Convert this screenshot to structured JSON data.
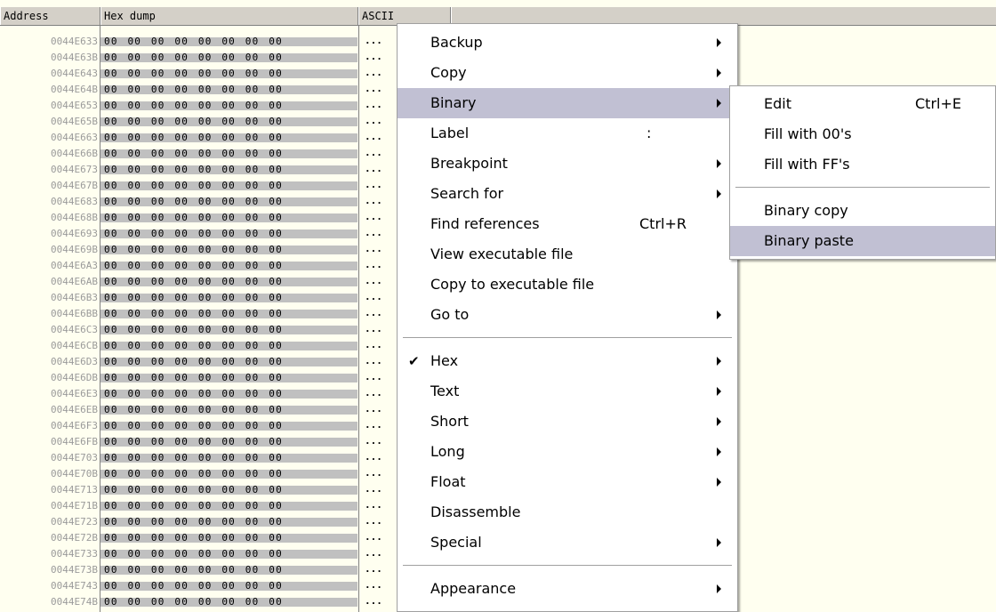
{
  "columns": {
    "address": "Address",
    "hex": "Hex dump",
    "ascii": "ASCII"
  },
  "dump_rows": [
    {
      "addr": "0044E633",
      "hex": "00 00 00 00 00 00 00 00",
      "ascii": "..."
    },
    {
      "addr": "0044E63B",
      "hex": "00 00 00 00 00 00 00 00",
      "ascii": "..."
    },
    {
      "addr": "0044E643",
      "hex": "00 00 00 00 00 00 00 00",
      "ascii": "..."
    },
    {
      "addr": "0044E64B",
      "hex": "00 00 00 00 00 00 00 00",
      "ascii": "..."
    },
    {
      "addr": "0044E653",
      "hex": "00 00 00 00 00 00 00 00",
      "ascii": "..."
    },
    {
      "addr": "0044E65B",
      "hex": "00 00 00 00 00 00 00 00",
      "ascii": "..."
    },
    {
      "addr": "0044E663",
      "hex": "00 00 00 00 00 00 00 00",
      "ascii": "..."
    },
    {
      "addr": "0044E66B",
      "hex": "00 00 00 00 00 00 00 00",
      "ascii": "..."
    },
    {
      "addr": "0044E673",
      "hex": "00 00 00 00 00 00 00 00",
      "ascii": "..."
    },
    {
      "addr": "0044E67B",
      "hex": "00 00 00 00 00 00 00 00",
      "ascii": "..."
    },
    {
      "addr": "0044E683",
      "hex": "00 00 00 00 00 00 00 00",
      "ascii": "..."
    },
    {
      "addr": "0044E68B",
      "hex": "00 00 00 00 00 00 00 00",
      "ascii": "..."
    },
    {
      "addr": "0044E693",
      "hex": "00 00 00 00 00 00 00 00",
      "ascii": "..."
    },
    {
      "addr": "0044E69B",
      "hex": "00 00 00 00 00 00 00 00",
      "ascii": "..."
    },
    {
      "addr": "0044E6A3",
      "hex": "00 00 00 00 00 00 00 00",
      "ascii": "..."
    },
    {
      "addr": "0044E6AB",
      "hex": "00 00 00 00 00 00 00 00",
      "ascii": "..."
    },
    {
      "addr": "0044E6B3",
      "hex": "00 00 00 00 00 00 00 00",
      "ascii": "..."
    },
    {
      "addr": "0044E6BB",
      "hex": "00 00 00 00 00 00 00 00",
      "ascii": "..."
    },
    {
      "addr": "0044E6C3",
      "hex": "00 00 00 00 00 00 00 00",
      "ascii": "..."
    },
    {
      "addr": "0044E6CB",
      "hex": "00 00 00 00 00 00 00 00",
      "ascii": "..."
    },
    {
      "addr": "0044E6D3",
      "hex": "00 00 00 00 00 00 00 00",
      "ascii": "..."
    },
    {
      "addr": "0044E6DB",
      "hex": "00 00 00 00 00 00 00 00",
      "ascii": "..."
    },
    {
      "addr": "0044E6E3",
      "hex": "00 00 00 00 00 00 00 00",
      "ascii": "..."
    },
    {
      "addr": "0044E6EB",
      "hex": "00 00 00 00 00 00 00 00",
      "ascii": "..."
    },
    {
      "addr": "0044E6F3",
      "hex": "00 00 00 00 00 00 00 00",
      "ascii": "..."
    },
    {
      "addr": "0044E6FB",
      "hex": "00 00 00 00 00 00 00 00",
      "ascii": "..."
    },
    {
      "addr": "0044E703",
      "hex": "00 00 00 00 00 00 00 00",
      "ascii": "..."
    },
    {
      "addr": "0044E70B",
      "hex": "00 00 00 00 00 00 00 00",
      "ascii": "..."
    },
    {
      "addr": "0044E713",
      "hex": "00 00 00 00 00 00 00 00",
      "ascii": "..."
    },
    {
      "addr": "0044E71B",
      "hex": "00 00 00 00 00 00 00 00",
      "ascii": "..."
    },
    {
      "addr": "0044E723",
      "hex": "00 00 00 00 00 00 00 00",
      "ascii": "..."
    },
    {
      "addr": "0044E72B",
      "hex": "00 00 00 00 00 00 00 00",
      "ascii": "..."
    },
    {
      "addr": "0044E733",
      "hex": "00 00 00 00 00 00 00 00",
      "ascii": "..."
    },
    {
      "addr": "0044E73B",
      "hex": "00 00 00 00 00 00 00 00",
      "ascii": "..."
    },
    {
      "addr": "0044E743",
      "hex": "00 00 00 00 00 00 00 00",
      "ascii": "..."
    },
    {
      "addr": "0044E74B",
      "hex": "00 00 00 00 00 00 00 00",
      "ascii": "..."
    }
  ],
  "context_menu": {
    "items": [
      {
        "label": "Backup",
        "shortcut": "",
        "submenu": true
      },
      {
        "label": "Copy",
        "shortcut": "",
        "submenu": true
      },
      {
        "label": "Binary",
        "shortcut": "",
        "submenu": true,
        "highlighted": true
      },
      {
        "label": "Label",
        "shortcut": ":",
        "submenu": false
      },
      {
        "label": "Breakpoint",
        "shortcut": "",
        "submenu": true
      },
      {
        "label": "Search for",
        "shortcut": "",
        "submenu": true
      },
      {
        "label": "Find references",
        "shortcut": "Ctrl+R",
        "submenu": false
      },
      {
        "label": "View executable file",
        "shortcut": "",
        "submenu": false
      },
      {
        "label": "Copy to executable file",
        "shortcut": "",
        "submenu": false
      },
      {
        "label": "Go to",
        "shortcut": "",
        "submenu": true
      },
      {
        "separator": true
      },
      {
        "label": "Hex",
        "shortcut": "",
        "submenu": true,
        "checked": true
      },
      {
        "label": "Text",
        "shortcut": "",
        "submenu": true
      },
      {
        "label": "Short",
        "shortcut": "",
        "submenu": true
      },
      {
        "label": "Long",
        "shortcut": "",
        "submenu": true
      },
      {
        "label": "Float",
        "shortcut": "",
        "submenu": true
      },
      {
        "label": "Disassemble",
        "shortcut": "",
        "submenu": false
      },
      {
        "label": "Special",
        "shortcut": "",
        "submenu": true
      },
      {
        "separator": true
      },
      {
        "label": "Appearance",
        "shortcut": "",
        "submenu": true
      }
    ]
  },
  "binary_submenu": {
    "items": [
      {
        "label": "Edit",
        "shortcut": "Ctrl+E"
      },
      {
        "label": "Fill with 00's",
        "shortcut": ""
      },
      {
        "label": "Fill with FF's",
        "shortcut": ""
      },
      {
        "separator": true
      },
      {
        "label": "Binary copy",
        "shortcut": ""
      },
      {
        "label": "Binary paste",
        "shortcut": "",
        "highlighted": true
      }
    ]
  },
  "colors": {
    "menu_highlight": "#c1c0d3",
    "hex_column_bg": "#c0c0c0",
    "pane_bg": "#fffff0",
    "address_text": "#9a9a9a"
  }
}
